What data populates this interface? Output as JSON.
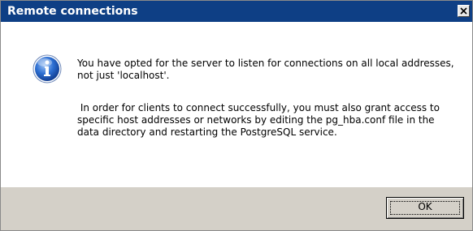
{
  "window": {
    "title": "Remote connections",
    "close_icon": "close-icon",
    "colors": {
      "titlebar": "#0e3f85",
      "title_text": "#ffffff",
      "footer": "#d4d0c8"
    }
  },
  "message": {
    "icon": "info-icon",
    "paragraph1": "You have opted for the server to listen for connections on all local addresses, not just 'localhost'.",
    "paragraph2": " In order for clients to connect successfully, you must also grant access to specific host addresses or networks by editing the pg_hba.conf file in the data directory and restarting the PostgreSQL service."
  },
  "buttons": {
    "ok_label": "OK"
  }
}
